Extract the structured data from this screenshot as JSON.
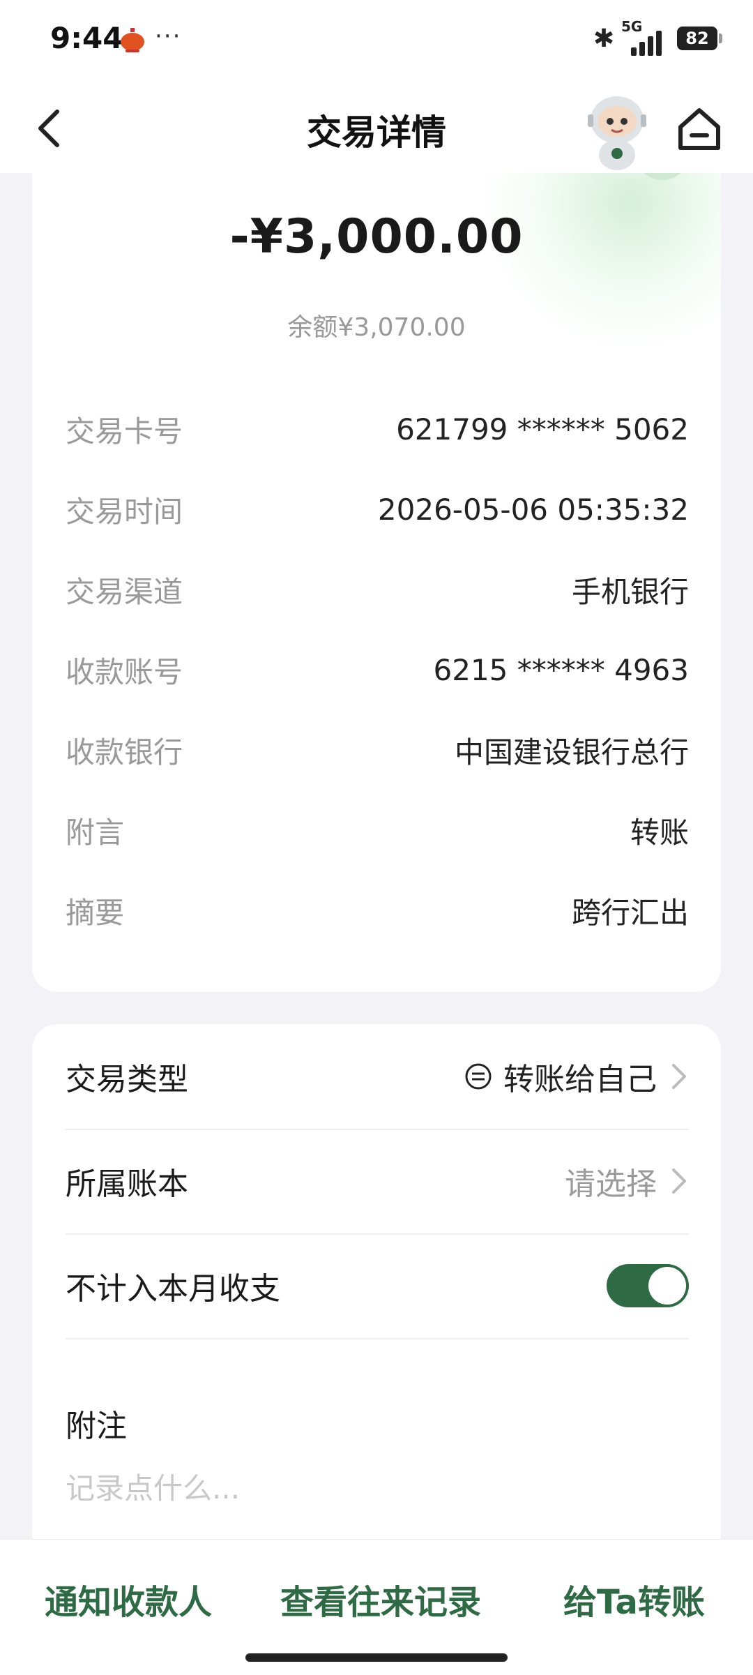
{
  "status_bar": {
    "time": "9:44",
    "dots": "···",
    "network": "5G",
    "battery": "82"
  },
  "nav": {
    "title": "交易详情"
  },
  "transaction": {
    "amount": "-¥3,000.00",
    "balance": "余额¥3,070.00",
    "details": [
      {
        "label": "交易卡号",
        "value": "621799 ****** 5062"
      },
      {
        "label": "交易时间",
        "value": "2026-05-06 05:35:32"
      },
      {
        "label": "交易渠道",
        "value": "手机银行"
      },
      {
        "label": "收款账号",
        "value": "6215 ****** 4963"
      },
      {
        "label": "收款银行",
        "value": "中国建设银行总行"
      },
      {
        "label": "附言",
        "value": "转账"
      },
      {
        "label": "摘要",
        "value": "跨行汇出"
      }
    ]
  },
  "options": {
    "type_label": "交易类型",
    "type_value": "转账给自己",
    "book_label": "所属账本",
    "book_value": "请选择",
    "exclude_label": "不计入本月收支",
    "exclude_on": true,
    "note_label": "附注",
    "note_placeholder": "记录点什么..."
  },
  "bottom_actions": {
    "notify": "通知收款人",
    "history": "查看往来记录",
    "transfer": "给Ta转账"
  },
  "colors": {
    "accent": "#2e6b44",
    "background": "#f3f2f7"
  },
  "icons": [
    "back-arrow-icon",
    "robot-assistant-icon",
    "home-icon",
    "transfer-type-icon",
    "chevron-right-icon",
    "bluetooth-icon",
    "signal-icon",
    "battery-icon",
    "lantern-icon"
  ]
}
